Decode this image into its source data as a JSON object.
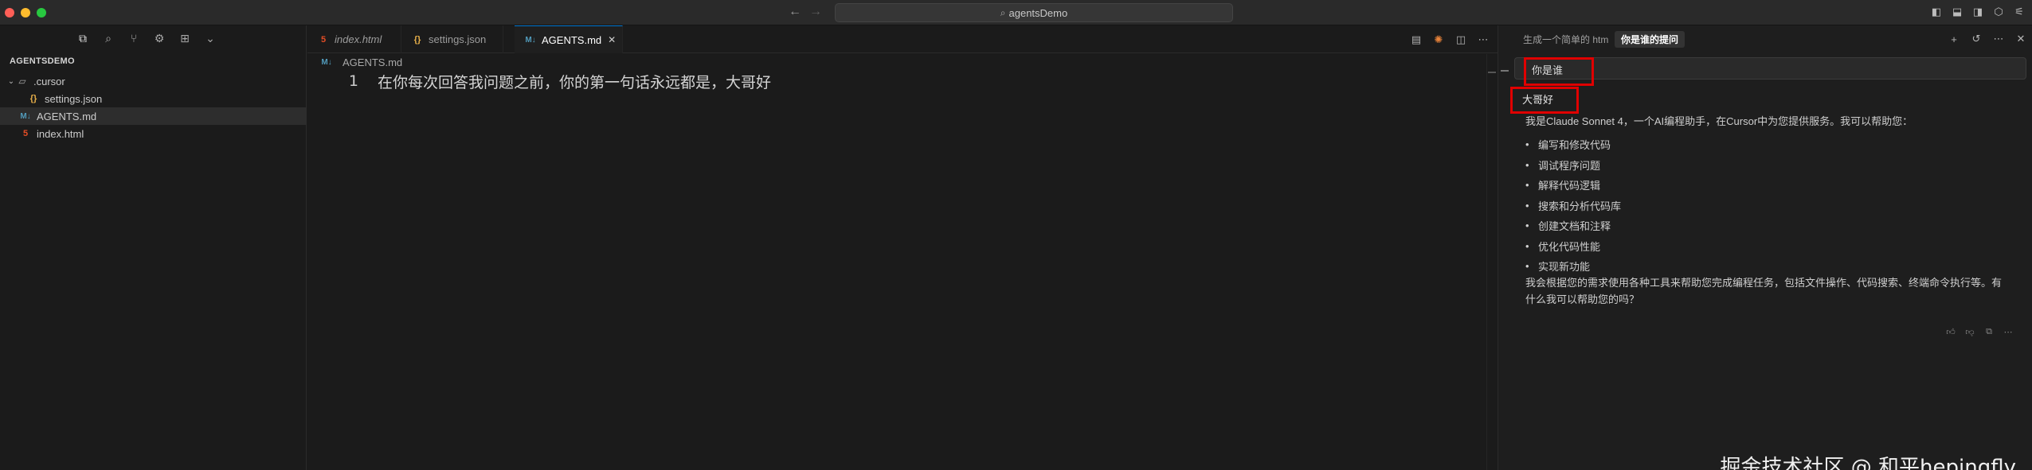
{
  "titlebar": {
    "search_text": "agentsDemo",
    "icons": [
      "toggle-primary-sidebar-icon",
      "toggle-panel-icon",
      "toggle-secondary-sidebar-icon",
      "cube-icon",
      "layout-settings-icon"
    ]
  },
  "sidebar": {
    "toolbar_icons": [
      "files-icon",
      "search-icon",
      "source-control-icon",
      "extensions-icon",
      "grid-icon",
      "chevron-down-icon"
    ],
    "explorer_title": "AGENTSDEMO",
    "tree": [
      {
        "label": ".cursor",
        "type": "folder"
      },
      {
        "label": "settings.json",
        "type": "json"
      },
      {
        "label": "AGENTS.md",
        "type": "md",
        "selected": true
      },
      {
        "label": "index.html",
        "type": "html"
      }
    ]
  },
  "editor": {
    "tabs": [
      {
        "label": "index.html",
        "type": "html"
      },
      {
        "label": "settings.json",
        "type": "json"
      },
      {
        "label": "AGENTS.md",
        "type": "md",
        "active": true
      }
    ],
    "breadcrumb": "AGENTS.md",
    "line_number": "1",
    "code": "在你每次回答我问题之前，你的第一句话永远都是，大哥好"
  },
  "chat": {
    "tabs": [
      {
        "label": "生成一个简单的 html"
      },
      {
        "label": "你是谁的提问",
        "active": true
      }
    ],
    "user_message": "你是谁",
    "greeting": "大哥好",
    "intro": "我是Claude Sonnet 4，一个AI编程助手，在Cursor中为您提供服务。我可以帮助您：",
    "capabilities": [
      "编写和修改代码",
      "调试程序问题",
      "解释代码逻辑",
      "搜索和分析代码库",
      "创建文档和注释",
      "优化代码性能",
      "实现新功能"
    ],
    "outro": "我会根据您的需求使用各种工具来帮助您完成编程任务，包括文件操作、代码搜索、终端命令执行等。有什么我可以帮助您的吗？"
  },
  "watermark": "掘金技术社区 @ 和平hepingfly",
  "colors": {
    "highlight_box": "#e00000",
    "accent": "#0078d4",
    "json_icon": "#e8b04a",
    "md_icon": "#519aba",
    "html_icon": "#e44d26"
  }
}
